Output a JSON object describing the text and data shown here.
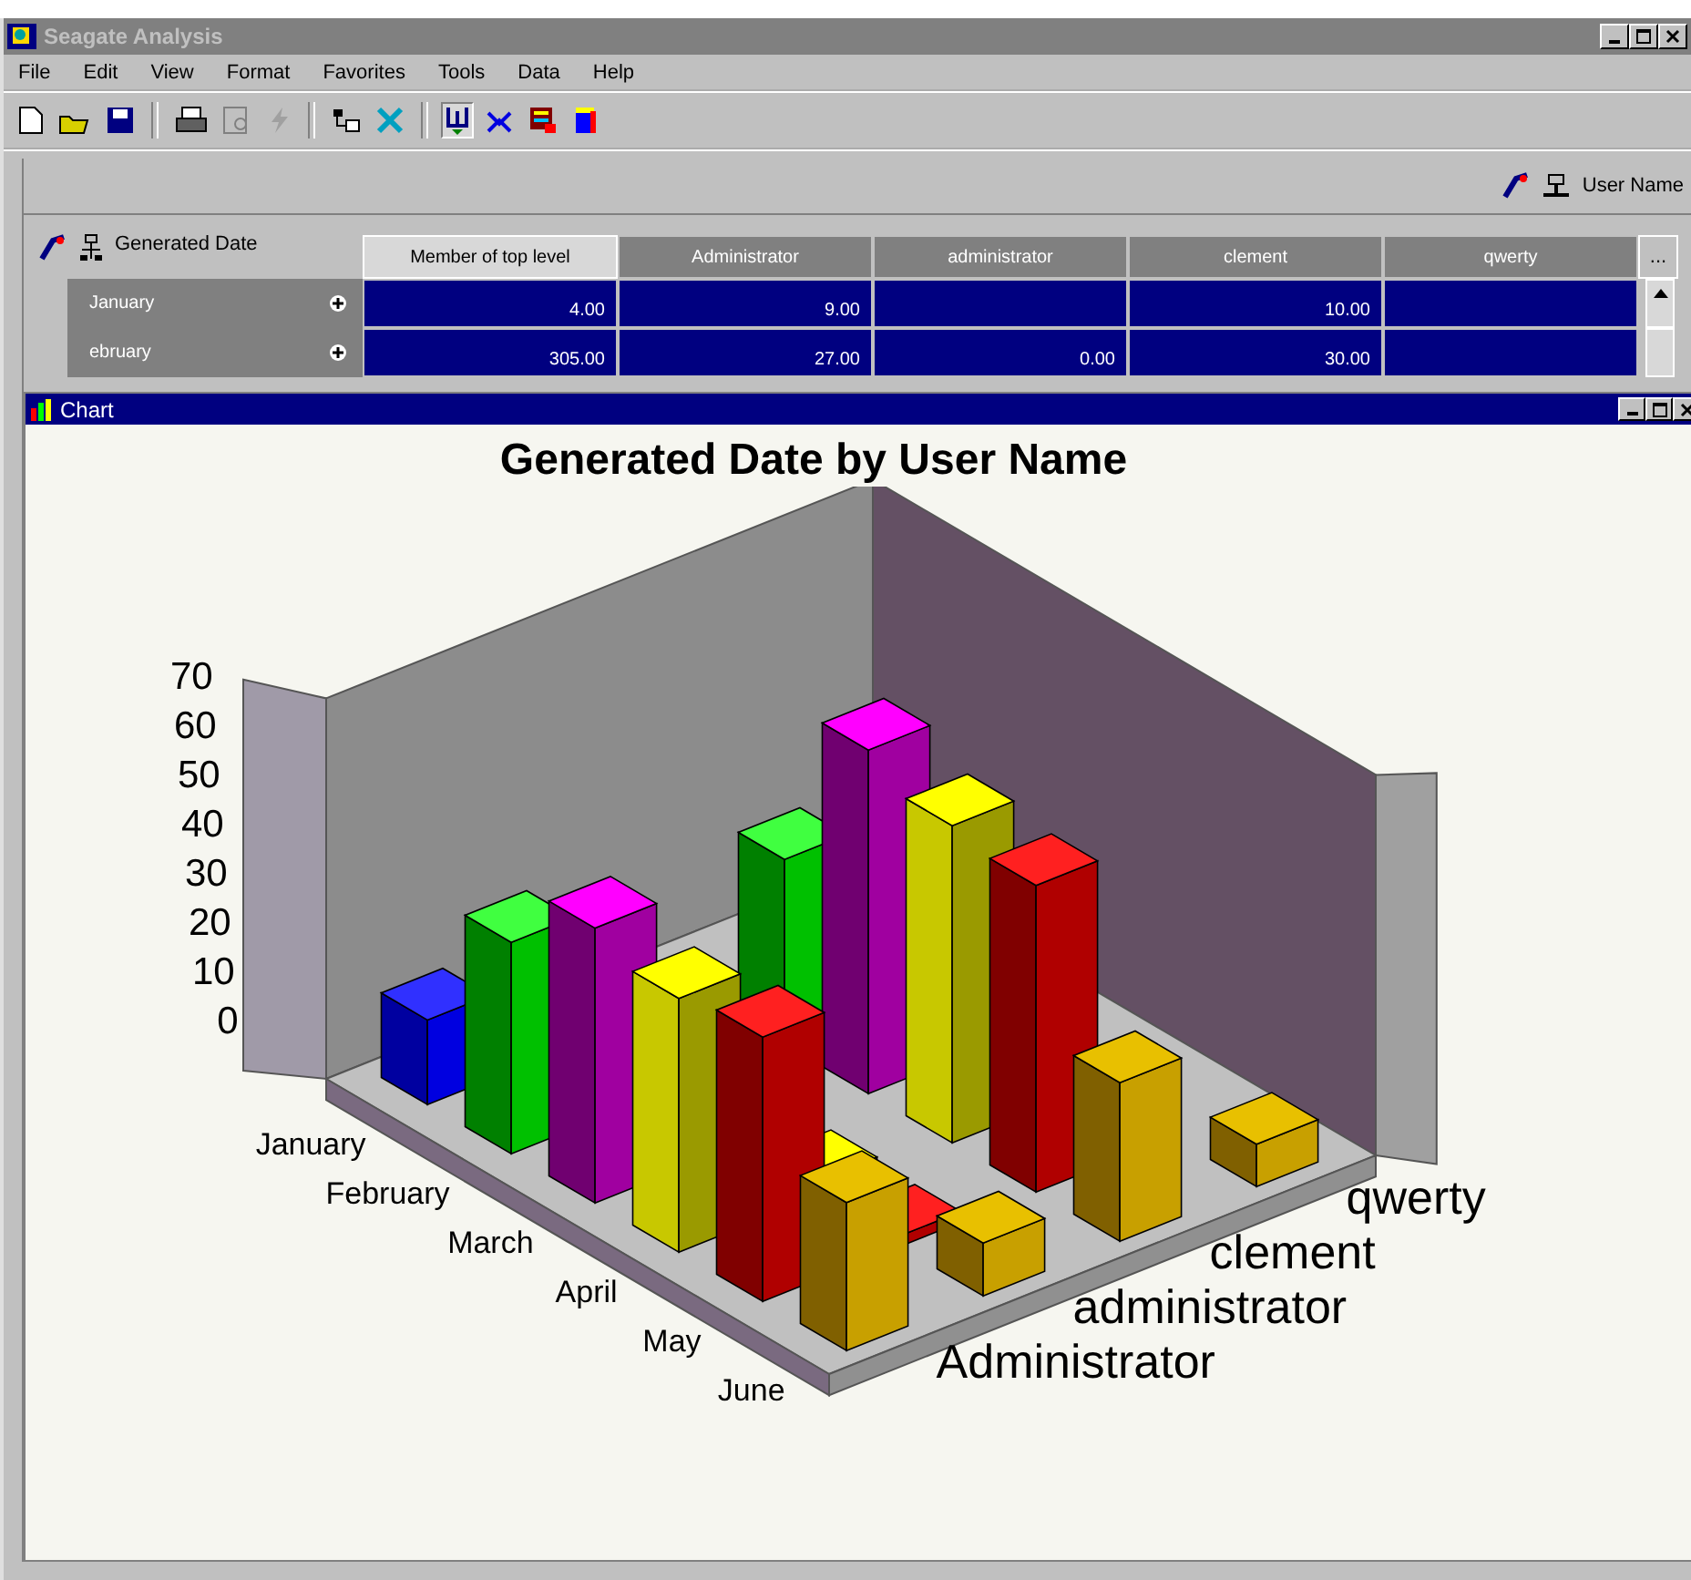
{
  "window": {
    "title": "Seagate Analysis"
  },
  "menu": [
    "File",
    "Edit",
    "View",
    "Format",
    "Favorites",
    "Tools",
    "Data",
    "Help"
  ],
  "grid": {
    "column_dimension": "User Name",
    "row_dimension": "Generated Date",
    "columns": [
      {
        "label": "Member of top level",
        "selected": false
      },
      {
        "label": "Administrator",
        "selected": true
      },
      {
        "label": "administrator",
        "selected": true
      },
      {
        "label": "clement",
        "selected": true
      },
      {
        "label": "qwerty",
        "selected": true
      }
    ],
    "more": "...",
    "rows": [
      {
        "label": "January",
        "selected": true,
        "cells": [
          "4.00",
          "9.00",
          "",
          "10.00",
          ""
        ]
      },
      {
        "label": "ebruary",
        "selected": true,
        "cells": [
          "305.00",
          "27.00",
          "0.00",
          "30.00",
          ""
        ]
      }
    ]
  },
  "chart_window": {
    "title": "Chart",
    "chart_title": "Generated Date by User Name",
    "y_ticks": [
      "70",
      "60",
      "50",
      "40",
      "30",
      "20",
      "10",
      "0"
    ],
    "months": [
      "January",
      "February",
      "March",
      "April",
      "May",
      "June"
    ],
    "users": [
      "Administrator",
      "administrator",
      "clement",
      "qwerty"
    ]
  }
}
